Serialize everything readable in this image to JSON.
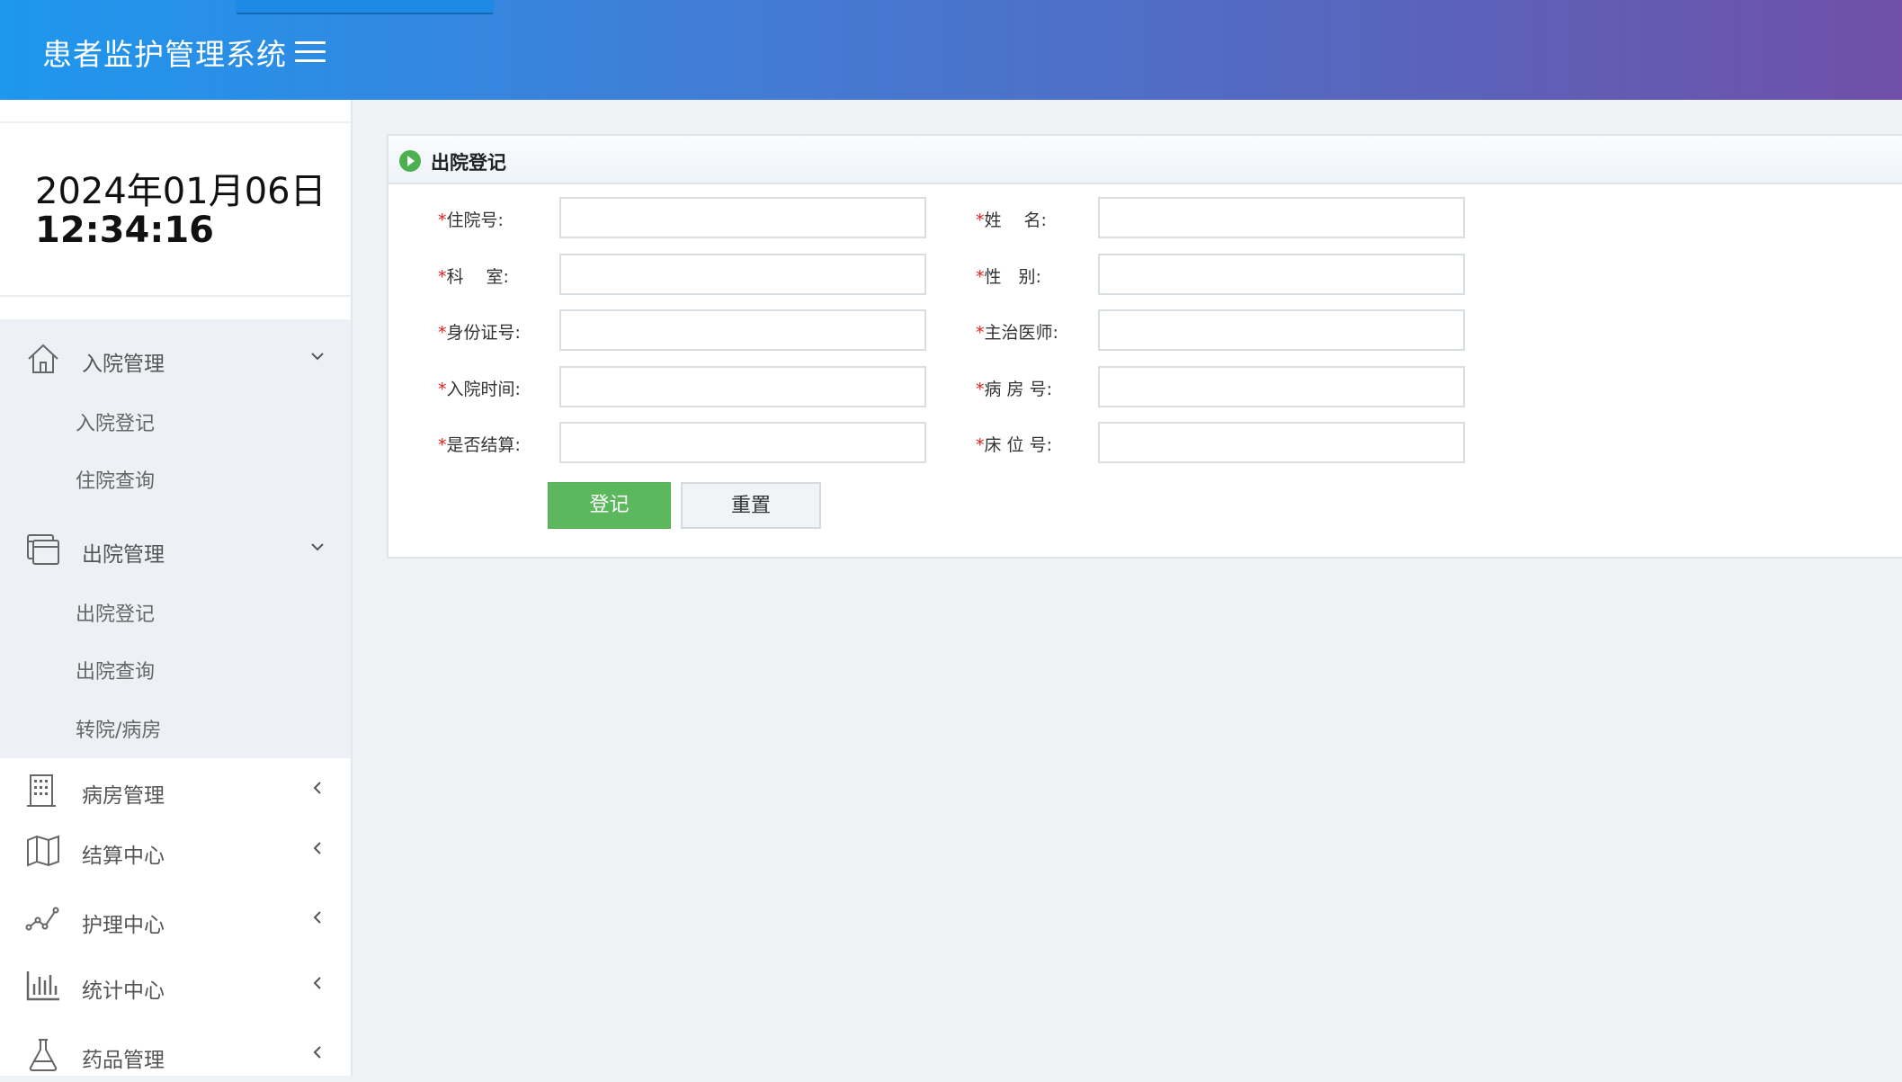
{
  "header": {
    "app_title": "患者监护管理系统",
    "menu_icon": "hamburger-icon"
  },
  "sidebar": {
    "clock": {
      "date": "2024年01月06日",
      "time": "12:34:16"
    },
    "groups": [
      {
        "label": "入院管理",
        "icon": "home-icon",
        "expanded": true,
        "children": [
          {
            "label": "入院登记"
          },
          {
            "label": "住院查询"
          }
        ]
      },
      {
        "label": "出院管理",
        "icon": "window-stack-icon",
        "expanded": true,
        "children": [
          {
            "label": "出院登记"
          },
          {
            "label": "出院查询"
          },
          {
            "label": "转院/病房"
          }
        ]
      },
      {
        "label": "病房管理",
        "icon": "building-icon",
        "expanded": false
      },
      {
        "label": "结算中心",
        "icon": "map-icon",
        "expanded": false
      },
      {
        "label": "护理中心",
        "icon": "line-chart-icon",
        "expanded": false
      },
      {
        "label": "统计中心",
        "icon": "bar-chart-icon",
        "expanded": false
      },
      {
        "label": "药品管理",
        "icon": "flask-icon",
        "expanded": false
      }
    ]
  },
  "form": {
    "title": "出院登记",
    "required_mark": "*",
    "fields": {
      "admission_no": {
        "label": "住院号:",
        "value": ""
      },
      "name": {
        "label": "姓　 名:",
        "value": ""
      },
      "department": {
        "label": "科　 室:",
        "value": ""
      },
      "gender": {
        "label": "性　别:",
        "value": ""
      },
      "id_card": {
        "label": "身份证号:",
        "value": ""
      },
      "doctor": {
        "label": "主治医师:",
        "value": ""
      },
      "admission_time": {
        "label": "入院时间:",
        "value": ""
      },
      "room_no": {
        "label": "病 房 号:",
        "value": ""
      },
      "settled": {
        "label": "是否结算:",
        "value": ""
      },
      "bed_no": {
        "label": "床 位 号:",
        "value": ""
      }
    },
    "buttons": {
      "submit": "登记",
      "reset": "重置"
    }
  },
  "colors": {
    "header_gradient_start": "#1e97ee",
    "header_gradient_end": "#7050a8",
    "primary_button": "#5cb85c",
    "required": "#e02020"
  }
}
